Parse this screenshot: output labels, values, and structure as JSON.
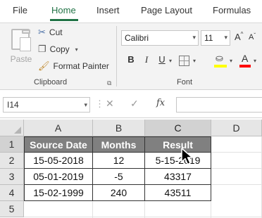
{
  "tabs": [
    "File",
    "Home",
    "Insert",
    "Page Layout",
    "Formulas"
  ],
  "active_tab": "Home",
  "clipboard": {
    "paste": "Paste",
    "cut": "Cut",
    "copy": "Copy",
    "format_painter": "Format Painter",
    "group": "Clipboard"
  },
  "font": {
    "name": "Calibri",
    "size": "11",
    "bold": "B",
    "italic": "I",
    "underline": "U",
    "grow": "A",
    "shrink": "A",
    "font_color": "A",
    "group": "Font"
  },
  "formula_bar": {
    "name_box": "I14",
    "fx": "fx",
    "value": ""
  },
  "columns": [
    "A",
    "B",
    "C",
    "D"
  ],
  "rows": [
    "1",
    "2",
    "3",
    "4",
    "5"
  ],
  "table": {
    "headers": [
      "Source Date",
      "Months",
      "Result"
    ],
    "rows": [
      [
        "15-05-2018",
        "12",
        "5-15-2019"
      ],
      [
        "05-01-2019",
        "-5",
        "43317"
      ],
      [
        "15-02-1999",
        "240",
        "43511"
      ]
    ]
  },
  "colors": {
    "accent": "#217346",
    "header_fill": "#808080",
    "header_text": "#ffffff",
    "font_color_bar": "#ff0000",
    "fill_color_bar": "#ffff00"
  }
}
